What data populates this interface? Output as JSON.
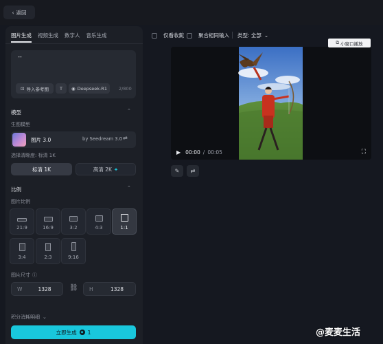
{
  "header": {
    "back_label": "返回"
  },
  "tabs": [
    {
      "label": "图片生成",
      "active": true
    },
    {
      "label": "视频生成",
      "active": false
    },
    {
      "label": "数字人",
      "active": false
    },
    {
      "label": "音乐生成",
      "active": false
    }
  ],
  "prompt": {
    "text": "--",
    "import_ref_label": "导入参考图",
    "text_tool_label": "T",
    "model_chip_label": "Deepseek-R1",
    "counter": "2/800"
  },
  "model_section": {
    "title": "模型",
    "sublabel": "生图模型",
    "model_name": "图片 3.0",
    "model_provider": "by Seedream 3.0",
    "resolution_label": "选择清晰度: 标清 1K",
    "res_options": [
      {
        "label": "标清 1K",
        "active": true
      },
      {
        "label": "高清 2K",
        "active": false,
        "badge": "✦"
      }
    ]
  },
  "ratio_section": {
    "title": "比例",
    "sublabel": "图片比例",
    "ratios": [
      {
        "label": "21:9",
        "active": false
      },
      {
        "label": "16:9",
        "active": false
      },
      {
        "label": "3:2",
        "active": false
      },
      {
        "label": "4:3",
        "active": false
      },
      {
        "label": "1:1",
        "active": true
      },
      {
        "label": "3:4",
        "active": false
      },
      {
        "label": "2:3",
        "active": false
      },
      {
        "label": "9:16",
        "active": false
      }
    ],
    "size_label": "图片尺寸",
    "width_label": "W",
    "width_value": "1328",
    "height_label": "H",
    "height_value": "1328"
  },
  "footer": {
    "points_label": "积分消耗明细",
    "generate_label": "立即生成",
    "generate_cost": "1"
  },
  "filters": {
    "favorites_label": "仅看收藏",
    "merge_label": "聚合相同输入",
    "type_label": "类型: 全部"
  },
  "pip_label": "小窗口播放",
  "player": {
    "current_time": "00:00",
    "duration": "00:05"
  },
  "watermark": "@麦麦生活",
  "colors": {
    "accent": "#19c7dc",
    "panel": "#1c1f26",
    "background": "#151820"
  }
}
